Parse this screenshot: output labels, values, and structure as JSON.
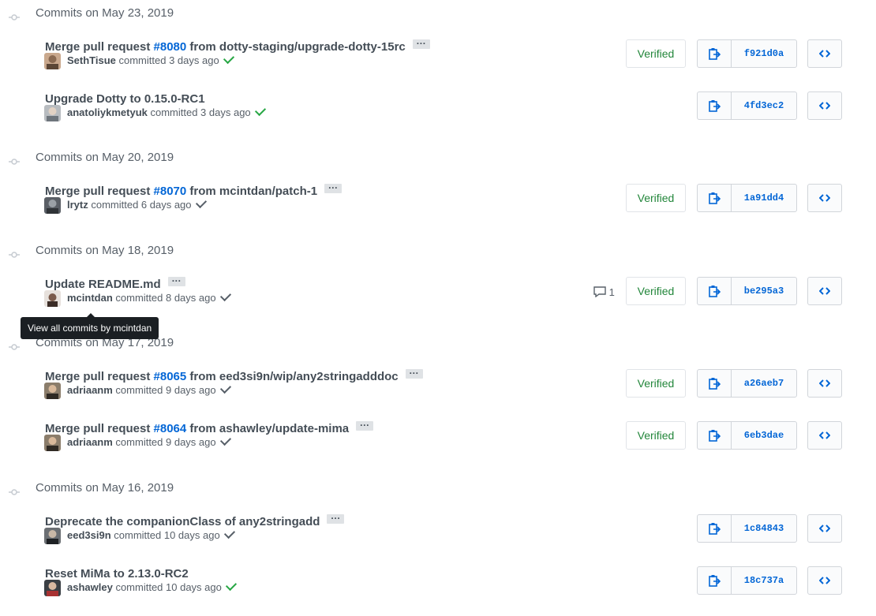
{
  "groups": [
    {
      "title": "Commits on May 23, 2019"
    },
    {
      "title": "Commits on May 20, 2019"
    },
    {
      "title": "Commits on May 18, 2019"
    },
    {
      "title": "Commits on May 17, 2019"
    },
    {
      "title": "Commits on May 16, 2019"
    }
  ],
  "commits": [
    {
      "msg_prefix": "Merge pull request ",
      "pr": "#8080",
      "msg_suffix": " from dotty-staging/upgrade-dotty-15rc",
      "author": "SethTisue",
      "action": " committed 3 days ago",
      "sha": "f921d0a",
      "verified": "Verified",
      "status": "success"
    },
    {
      "msg_prefix": "Upgrade Dotty to 0.15.0-RC1",
      "pr": "",
      "msg_suffix": "",
      "author": "anatoliykmetyuk",
      "action": " committed 3 days ago",
      "sha": "4fd3ec2",
      "verified": "",
      "status": "success"
    },
    {
      "msg_prefix": "Merge pull request ",
      "pr": "#8070",
      "msg_suffix": " from mcintdan/patch-1",
      "author": "lrytz",
      "action": " committed 6 days ago",
      "sha": "1a91dd4",
      "verified": "Verified",
      "status": "neutral"
    },
    {
      "msg_prefix": "Update README.md",
      "pr": "",
      "msg_suffix": "",
      "author": "mcintdan",
      "action": " committed 8 days ago",
      "sha": "be295a3",
      "verified": "Verified",
      "status": "neutral",
      "comments": "1"
    },
    {
      "msg_prefix": "Merge pull request ",
      "pr": "#8065",
      "msg_suffix": " from eed3si9n/wip/any2stringadddoc",
      "author": "adriaanm",
      "action": " committed 9 days ago",
      "sha": "a26aeb7",
      "verified": "Verified",
      "status": "neutral"
    },
    {
      "msg_prefix": "Merge pull request ",
      "pr": "#8064",
      "msg_suffix": " from ashawley/update-mima",
      "author": "adriaanm",
      "action": " committed 9 days ago",
      "sha": "6eb3dae",
      "verified": "Verified",
      "status": "neutral"
    },
    {
      "msg_prefix": "Deprecate the companionClass of any2stringadd",
      "pr": "",
      "msg_suffix": "",
      "author": "eed3si9n",
      "action": " committed 10 days ago",
      "sha": "1c84843",
      "verified": "",
      "status": "neutral"
    },
    {
      "msg_prefix": "Reset MiMa to 2.13.0-RC2",
      "pr": "",
      "msg_suffix": "",
      "author": "ashawley",
      "action": " committed 10 days ago",
      "sha": "18c737a",
      "verified": "",
      "status": "success"
    }
  ],
  "tooltip": "View all commits by mcintdan",
  "colors": {
    "link": "#0366d6",
    "verified": "#22863a",
    "success": "#28a745",
    "tooltip_bg": "#1b1f23"
  },
  "icons": {
    "group": "git-commit-icon",
    "copy": "clipboard-icon",
    "browse": "code-icon",
    "comment": "comment-icon"
  }
}
